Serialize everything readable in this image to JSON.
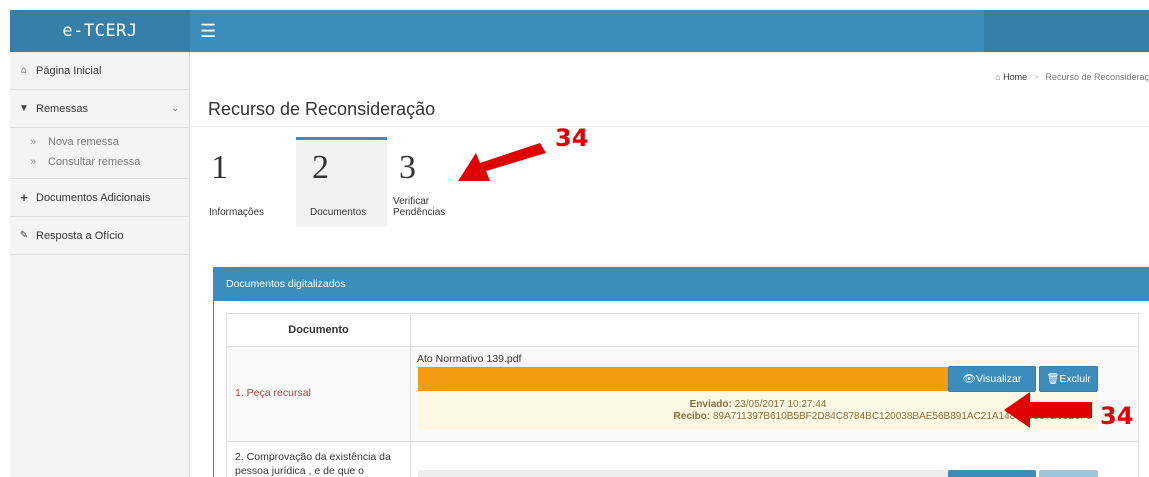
{
  "app": {
    "brand": "e-TCERJ",
    "topbar_right_text": ""
  },
  "sidebar": {
    "items": [
      {
        "label": "Página Inicial",
        "icon": "home-icon"
      },
      {
        "label": "Remessas",
        "icon": "caret-down-icon"
      },
      {
        "label": "Documentos Adicionais",
        "icon": "plus-icon"
      },
      {
        "label": "Resposta a Ofício",
        "icon": "edit-icon"
      }
    ],
    "sub_items": [
      {
        "label": "Nova remessa"
      },
      {
        "label": "Consultar remessa"
      }
    ]
  },
  "breadcrumb": {
    "home": "Home",
    "current": "Recurso de Reconsideraç"
  },
  "page": {
    "title": "Recurso de Reconsideração"
  },
  "wizard": {
    "steps": [
      {
        "number": "1",
        "label": "Informações"
      },
      {
        "number": "2",
        "label": "Documentos",
        "active": true
      },
      {
        "number": "3",
        "label_line1": "Verificar",
        "label_line2": "Pendências"
      }
    ]
  },
  "panel": {
    "title": "Documentos digitalizados",
    "table": {
      "header": "Documento",
      "rows": [
        {
          "name": "1. Peça recursal",
          "file": "Ato Normativo 139.pdf",
          "progress_pct": 100,
          "view_button": "Visualizar",
          "delete_button": "Excluir",
          "sent_label": "Enviado:",
          "sent_value": "23/05/2017 10:27:44",
          "receipt_label": "Recibo:",
          "receipt_value": "89A711397B610B5BF2D84C8784BC120038BAE56B891AC21A148022C37E95B8F9"
        },
        {
          "name_line1": "2. Comprovação da existência da",
          "name_line2": "pessoa jurídica , e de que o"
        }
      ]
    }
  },
  "annotations": {
    "step_callout": "34",
    "receipt_callout": "34"
  },
  "colors": {
    "primary": "#3c8dbc",
    "progress": "#f39c12",
    "warning_bg": "#fcf8e3",
    "annotation": "#e00000"
  }
}
